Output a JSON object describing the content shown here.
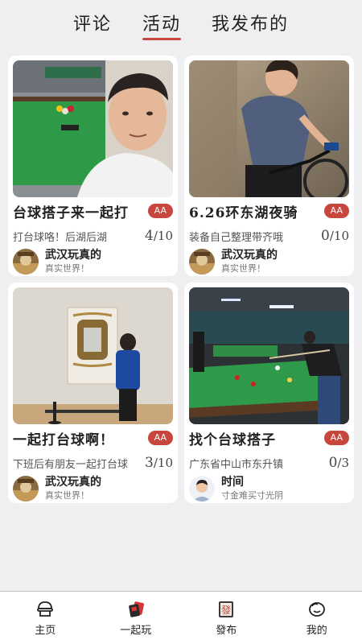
{
  "top_tabs": [
    {
      "label": "评论"
    },
    {
      "label": "活动"
    },
    {
      "label": "我发布的"
    }
  ],
  "active_tab_index": 1,
  "accent_color": "#c7473f",
  "cards": [
    {
      "title": "台球搭子来一起打",
      "badge": "AA",
      "desc": "打台球咯！后湖后湖",
      "count_current": "4",
      "count_total": "/10",
      "user_name": "武汉玩真的",
      "user_sig": "真实世界！",
      "photo": "man-selfie-at-pool-table"
    },
    {
      "title": "6.26环东湖夜骑",
      "badge": "AA",
      "desc": "装备自己整理带齐哦",
      "count_current": "0",
      "count_total": "/10",
      "user_name": "武汉玩真的",
      "user_sig": "真实世界！",
      "photo": "woman-cyclist"
    },
    {
      "title": "一起打台球啊！",
      "badge": "AA",
      "desc": "下班后有朋友一起打台球",
      "count_current": "3",
      "count_total": "/10",
      "user_name": "武汉玩真的",
      "user_sig": "真实世界！",
      "photo": "person-viewing-framed-mirror"
    },
    {
      "title": "找个台球搭子",
      "badge": "AA",
      "desc": "广东省中山市东升镇",
      "count_current": "0",
      "count_total": "/3",
      "user_name": "时间",
      "user_sig": "寸金难买寸光阴",
      "photo": "billiard-hall"
    }
  ],
  "bottom_nav": [
    {
      "label": "主页",
      "icon": "home-icon"
    },
    {
      "label": "一起玩",
      "icon": "play-together-icon"
    },
    {
      "label": "發布",
      "icon": "publish-icon"
    },
    {
      "label": "我的",
      "icon": "profile-icon"
    }
  ],
  "publish_icon_char": "發"
}
